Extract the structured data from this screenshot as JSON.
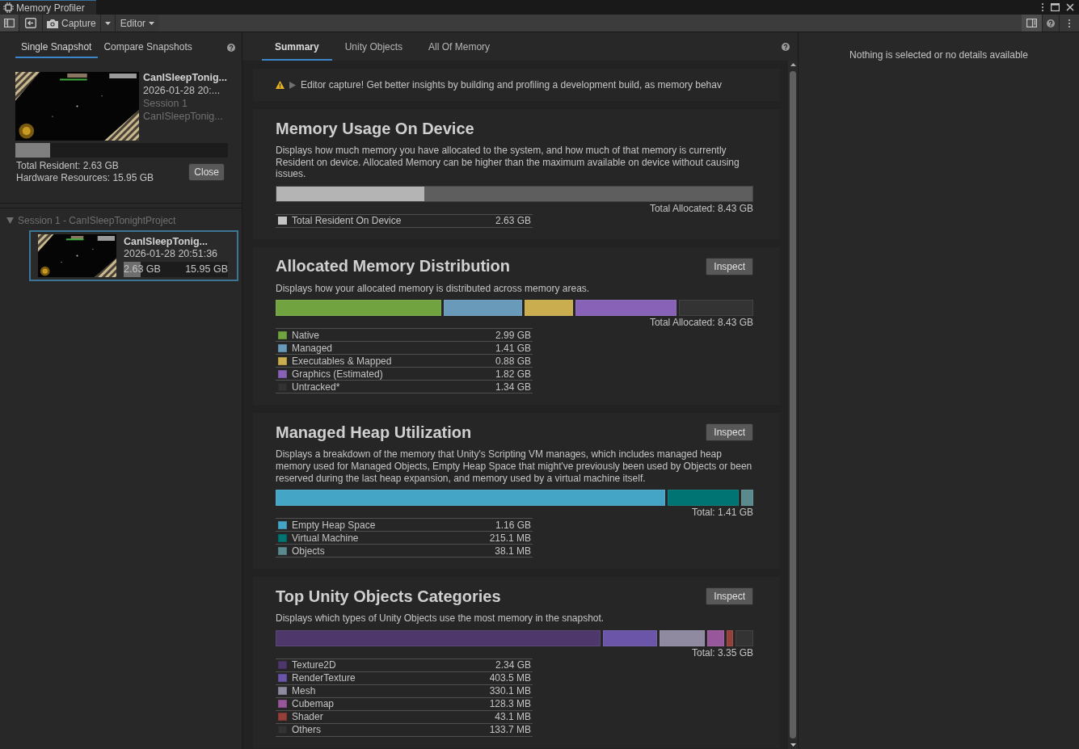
{
  "window": {
    "tab_title": "Memory Profiler"
  },
  "toolbar": {
    "capture_label": "Capture",
    "target_label": "Editor"
  },
  "left_panel": {
    "tabs": [
      {
        "label": "Single Snapshot",
        "selected": true
      },
      {
        "label": "Compare Snapshots",
        "selected": false
      }
    ],
    "open_snapshot": {
      "name": "CanISleepTonig...",
      "date": "2026-01-28 20:...",
      "session": "Session 1",
      "project": "CanISleepTonig...",
      "level": 0.165,
      "total_resident": "Total Resident: 2.63 GB",
      "hardware_resources": "Hardware Resources: 15.95 GB",
      "close_label": "Close"
    },
    "sessions": [
      {
        "label": "Session 1 - CanISleepTonightProject",
        "expanded": true,
        "children": [
          {
            "name": "CanISleepTonig...",
            "date": "2026-01-28 20:51:36",
            "level": 0.165,
            "used": "2.63 GB",
            "total": "15.95 GB",
            "selected": true
          }
        ]
      }
    ]
  },
  "main": {
    "tabs": [
      {
        "label": "Summary",
        "selected": true
      },
      {
        "label": "Unity Objects",
        "selected": false
      },
      {
        "label": "All Of Memory",
        "selected": false
      }
    ],
    "warning": "Editor capture! Get better insights by building and profiling a development build, as memory behav",
    "sections": [
      {
        "title": "Memory Usage On Device",
        "description": "Displays how much memory you have allocated to the system, and how much of that memory is currently Resident on device. Allocated Memory can be higher than the maximum available on device without causing issues.",
        "kind": "fill",
        "total": "Total Allocated: 8.43 GB",
        "items": [
          {
            "label": "Total Resident On Device",
            "value": "2.63 GB",
            "level": 0.31
          }
        ]
      },
      {
        "title": "Allocated Memory Distribution",
        "inspect_label": "Inspect",
        "description": "Displays how your allocated memory is distributed across memory areas.",
        "kind": "segments",
        "total": "Total Allocated: 8.43 GB",
        "items": [
          {
            "label": "Native",
            "value": "2.99 GB",
            "color": "#71a340"
          },
          {
            "label": "Managed",
            "value": "1.41 GB",
            "color": "#6a9ab9"
          },
          {
            "label": "Executables & Mapped",
            "value": "0.88 GB",
            "color": "#c9ad4e"
          },
          {
            "label": "Graphics (Estimated)",
            "value": "1.82 GB",
            "color": "#8862b6"
          },
          {
            "label": "Untracked*",
            "value": "1.34 GB",
            "color": "#333333"
          }
        ]
      },
      {
        "title": "Managed Heap Utilization",
        "inspect_label": "Inspect",
        "description": "Displays a breakdown of the memory that Unity's Scripting VM manages, which includes managed heap memory used for Managed Objects, Empty Heap Space that might've previously been used by Objects or been reserved during the last heap expansion, and memory used by a virtual machine itself.",
        "kind": "segments",
        "total": "Total: 1.41 GB",
        "items": [
          {
            "label": "Empty Heap Space",
            "value": "1.16 GB",
            "color": "#45a5c7"
          },
          {
            "label": "Virtual Machine",
            "value": "215.1 MB",
            "color": "#007473"
          },
          {
            "label": "Objects",
            "value": "38.1 MB",
            "color": "#5a8a8e"
          }
        ]
      },
      {
        "title": "Top Unity Objects Categories",
        "inspect_label": "Inspect",
        "description": "Displays which types of Unity Objects use the most memory in the snapshot.",
        "kind": "segments",
        "total": "Total: 3.35 GB",
        "items": [
          {
            "label": "Texture2D",
            "value": "2.34 GB",
            "color": "#4e376a"
          },
          {
            "label": "RenderTexture",
            "value": "403.5 MB",
            "color": "#6a55a8"
          },
          {
            "label": "Mesh",
            "value": "330.1 MB",
            "color": "#8f8aa0"
          },
          {
            "label": "Cubemap",
            "value": "128.3 MB",
            "color": "#98579a"
          },
          {
            "label": "Shader",
            "value": "43.1 MB",
            "color": "#943f39"
          },
          {
            "label": "Others",
            "value": "133.7 MB",
            "color": "#333333"
          }
        ]
      }
    ]
  },
  "details": {
    "message": "Nothing is selected or no details available"
  }
}
